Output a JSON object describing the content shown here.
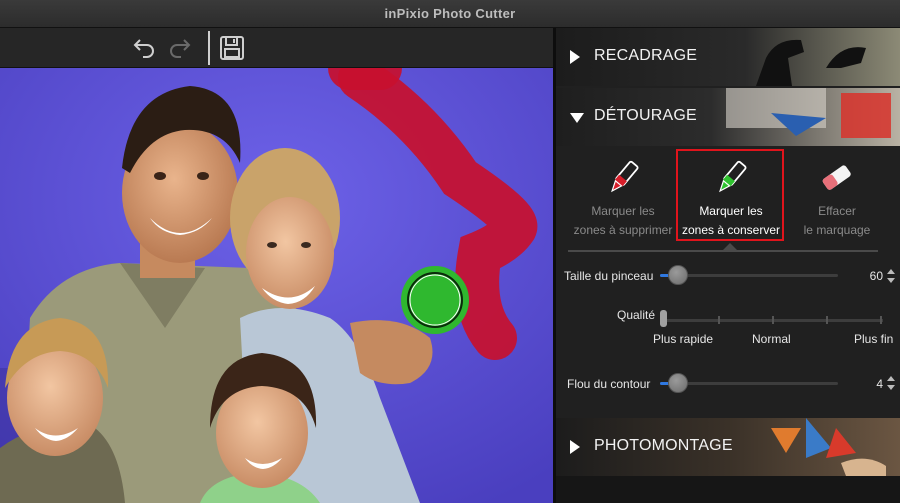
{
  "window": {
    "title": "inPixio Photo Cutter"
  },
  "toolbar": {
    "undo_icon": "undo-icon",
    "redo_icon": "redo-icon",
    "save_icon": "save-icon"
  },
  "sections": {
    "recadrage": {
      "label": "RECADRAGE",
      "expanded": false
    },
    "detourage": {
      "label": "DÉTOURAGE",
      "expanded": true
    },
    "photomontage": {
      "label": "PHOTOMONTAGE",
      "expanded": false
    }
  },
  "tools": [
    {
      "line1": "Marquer les",
      "line2": "zones à supprimer",
      "icon": "red-marker-icon",
      "active": false
    },
    {
      "line1": "Marquer les",
      "line2": "zones à conserver",
      "icon": "green-marker-icon",
      "active": true
    },
    {
      "line1": "Effacer",
      "line2": "le marquage",
      "icon": "eraser-icon",
      "active": false
    }
  ],
  "brush_size": {
    "label": "Taille du pinceau",
    "value": "60",
    "level": 0.07
  },
  "quality": {
    "label": "Qualité",
    "options": [
      "Plus rapide",
      "Normal",
      "Plus fin"
    ],
    "level": 0
  },
  "edge_blur": {
    "label": "Flou du contour",
    "value": "4",
    "level": 0.07
  },
  "colors": {
    "accent": "#2f78e0",
    "highlight": "#e0141c",
    "keep_marker": "#2fb82f",
    "remove_marker": "#c8102e",
    "background_mask": "#5a4fd0"
  }
}
